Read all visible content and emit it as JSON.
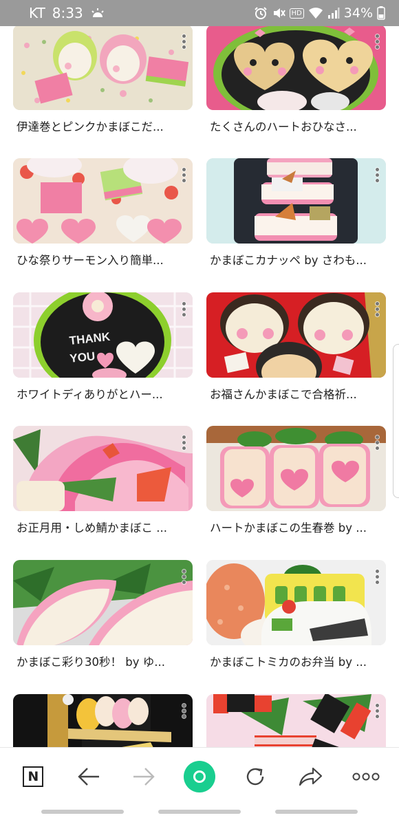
{
  "status_bar": {
    "carrier": "KT",
    "time": "8:33",
    "hd_label": "HD",
    "battery": "34%",
    "icons": [
      "weather-sunrise-icon",
      "alarm-icon",
      "mute-icon",
      "wifi-icon",
      "signal-icon",
      "battery-icon"
    ]
  },
  "recipes": [
    {
      "title": "伊達巻とピンクかまぼこだ..."
    },
    {
      "title": "たくさんのハートおひなさ..."
    },
    {
      "title": "ひな祭りサーモン入り簡単..."
    },
    {
      "title": "かまぼこカナッペ by さわも..."
    },
    {
      "title": "ホワイトディありがとハー..."
    },
    {
      "title": "お福さんかまぼこで合格祈..."
    },
    {
      "title": "お正月用・しめ鯖かまぼこ ..."
    },
    {
      "title": "ハートかまぼこの生春巻 by ..."
    },
    {
      "title": "かまぼこ彩り30秒！ by ゆ..."
    },
    {
      "title": "かまぼこトミカのお弁当 by ..."
    },
    {
      "title": ""
    },
    {
      "title": ""
    }
  ],
  "thumb_text": {
    "thank": "THANK",
    "you": "YOU"
  },
  "toolbar": {
    "home_label": "N",
    "icons": [
      "naver-home-icon",
      "back-arrow-icon",
      "forward-arrow-icon",
      "green-dot-icon",
      "refresh-icon",
      "share-icon",
      "more-icon"
    ]
  },
  "colors": {
    "status_bar_bg": "#9a9a9a",
    "accent_green": "#19ce8f",
    "kamaboko_pink": "#f49ab8"
  }
}
